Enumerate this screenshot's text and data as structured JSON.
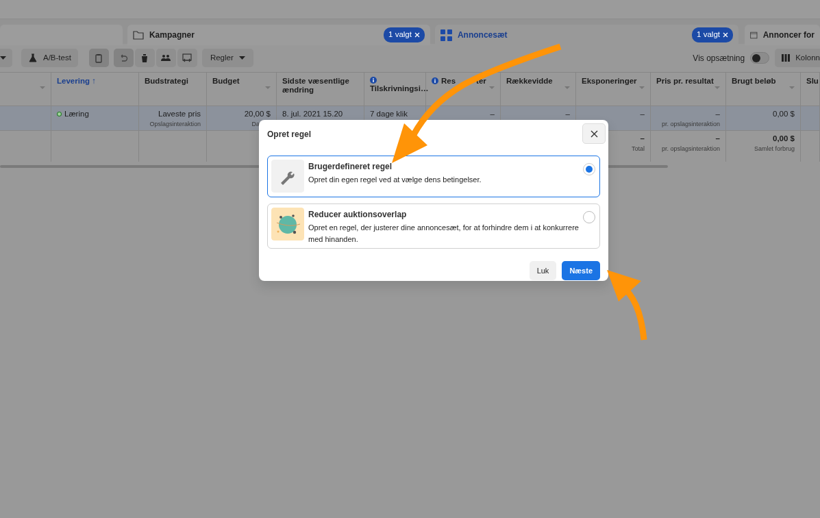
{
  "tabs": [
    {
      "label": "Kampagner",
      "selected": false,
      "badge": "1 valgt"
    },
    {
      "label": "Annoncesæt",
      "selected": true,
      "badge": "1 valgt"
    },
    {
      "label": "Annoncer for",
      "selected": false
    }
  ],
  "toolbar": {
    "items": [
      {
        "kind": "dropdown-stub"
      },
      {
        "kind": "labeled",
        "label": "A/B-test"
      },
      {
        "kind": "icon",
        "pressed": true
      },
      {
        "kind": "icon",
        "pressed": true
      },
      {
        "kind": "icon",
        "pressed": false
      },
      {
        "kind": "icon",
        "pressed": false
      },
      {
        "kind": "icon",
        "pressed": false
      },
      {
        "kind": "dropdown",
        "label": "Regler"
      }
    ],
    "setup_toggle": {
      "label": "Vis opsætning",
      "on": false
    },
    "columns_button": {
      "label": "Kolonn"
    }
  },
  "table": {
    "columns": [
      {
        "menu": true
      },
      {
        "label": "Levering",
        "sort_arrow": "↑",
        "sorted": true
      },
      {
        "label": "Budstrategi"
      },
      {
        "label": "Budget",
        "menu": true
      },
      {
        "label": "Sidste væsentlige ændring"
      },
      {
        "label": "Tilskrivningsi…",
        "info": true
      },
      {
        "label": "Res",
        "label_after_cover": "ter",
        "info": true,
        "info_inline": true,
        "menu": true
      },
      {
        "label": "Rækkevidde",
        "menu": true
      },
      {
        "label": "Eksponeringer",
        "menu": true
      },
      {
        "label": "Pris pr. resultat",
        "menu": true
      },
      {
        "label": "Brugt beløb",
        "menu": true
      },
      {
        "label": "Slu"
      }
    ],
    "rows": [
      {
        "selected": true,
        "cells": [
          {},
          {
            "text": "Læring",
            "status_dot": true
          },
          {
            "text": "Laveste pris",
            "sub": "Opslagsinteraktion"
          },
          {
            "text": "20,00 $",
            "sub": "Da"
          },
          {
            "text": "8. jul. 2021 15.20"
          },
          {
            "text": "7 dage klik"
          },
          {
            "text": "–"
          },
          {
            "text": "–"
          },
          {
            "text": "–"
          },
          {
            "text": "–",
            "sub": "pr. opslagsinteraktion"
          },
          {
            "text": "0,00 $"
          },
          {}
        ]
      }
    ],
    "summary": [
      {
        "text": "–",
        "sub": "Total"
      },
      {
        "text": "–",
        "sub": "pr. opslagsinteraktion"
      },
      {
        "text": "0,00 $",
        "sub": "Samlet forbrug"
      }
    ]
  },
  "dialog": {
    "title": "Opret regel",
    "options": [
      {
        "kind": "custom",
        "title": "Brugerdefineret regel",
        "description": "Opret din egen regel ved at vælge dens betingelser.",
        "selected": true
      },
      {
        "kind": "overlap",
        "title": "Reducer auktionsoverlap",
        "description": "Opret en regel, der justerer dine annoncesæt, for at forhindre dem i at konkurrere med hinanden.",
        "selected": false
      }
    ],
    "buttons": [
      {
        "label": "Luk",
        "kind": "secondary"
      },
      {
        "label": "Næste",
        "kind": "primary"
      }
    ]
  }
}
